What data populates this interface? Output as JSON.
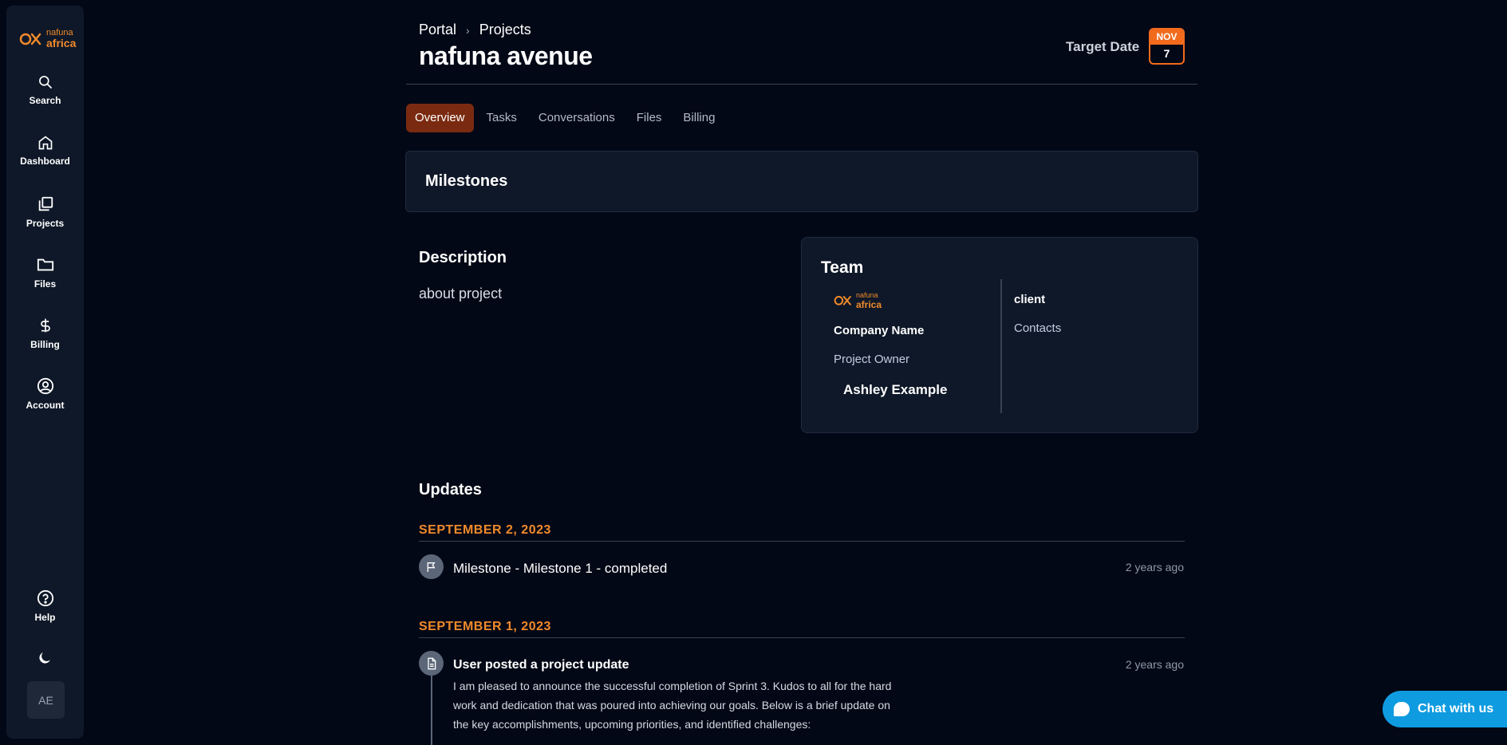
{
  "sidebar": {
    "logo": {
      "line1": "nafuna",
      "line2": "africa"
    },
    "items": [
      {
        "label": "Search",
        "icon": "search-icon"
      },
      {
        "label": "Dashboard",
        "icon": "home-icon"
      },
      {
        "label": "Projects",
        "icon": "projects-icon"
      },
      {
        "label": "Files",
        "icon": "folder-icon"
      },
      {
        "label": "Billing",
        "icon": "dollar-icon"
      },
      {
        "label": "Account",
        "icon": "user-circle-icon"
      }
    ],
    "help": {
      "label": "Help",
      "icon": "help-icon"
    },
    "theme_icon": "moon-icon",
    "avatar_initials": "AE"
  },
  "header": {
    "breadcrumb": [
      "Portal",
      "Projects"
    ],
    "title": "nafuna avenue",
    "target_date_label": "Target Date",
    "target_month": "NOV",
    "target_day": "7"
  },
  "tabs": [
    {
      "label": "Overview",
      "active": true
    },
    {
      "label": "Tasks",
      "active": false
    },
    {
      "label": "Conversations",
      "active": false
    },
    {
      "label": "Files",
      "active": false
    },
    {
      "label": "Billing",
      "active": false
    }
  ],
  "milestones": {
    "title": "Milestones"
  },
  "description": {
    "title": "Description",
    "text": "about project"
  },
  "team": {
    "title": "Team",
    "logo": {
      "line1": "nafuna",
      "line2": "africa"
    },
    "company_name": "Company Name",
    "owner_label": "Project Owner",
    "owner_name": "Ashley Example",
    "client_label": "client",
    "contacts_label": "Contacts"
  },
  "updates": {
    "title": "Updates",
    "groups": [
      {
        "date": "SEPTEMBER 2, 2023",
        "entries": [
          {
            "icon": "flag-icon",
            "text": "Milestone - Milestone 1 - completed",
            "time": "2 years ago"
          }
        ]
      },
      {
        "date": "SEPTEMBER 1, 2023",
        "entries": [
          {
            "icon": "document-icon",
            "text": "User posted a project update",
            "time": "2 years ago",
            "body": "I am pleased to announce the successful completion of Sprint 3. Kudos to all for the hard work and dedication that was poured into achieving our goals. Below is a brief update on the key accomplishments, upcoming priorities, and identified challenges:"
          }
        ]
      }
    ]
  },
  "chat": {
    "label": "Chat with us"
  },
  "colors": {
    "background": "#030816",
    "panel": "#0f1828",
    "accent": "#f26b1d",
    "active_tab": "#7a2a10",
    "chat": "#0f9be0"
  }
}
